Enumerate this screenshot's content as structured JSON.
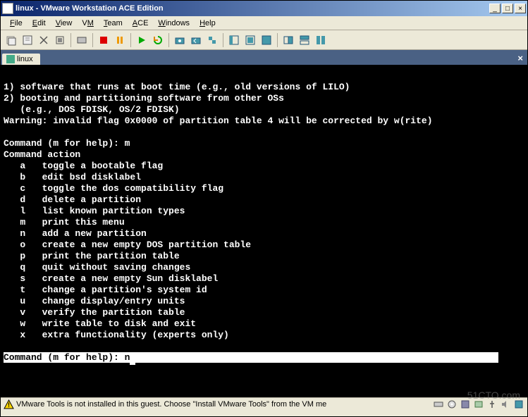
{
  "window": {
    "title": "linux - VMware Workstation ACE Edition"
  },
  "menu": {
    "file": "File",
    "edit": "Edit",
    "view": "View",
    "vm": "VM",
    "team": "Team",
    "ace": "ACE",
    "windows": "Windows",
    "help": "Help"
  },
  "tab": {
    "label": "linux"
  },
  "terminal": {
    "l1": "1) software that runs at boot time (e.g., old versions of LILO)",
    "l2": "2) booting and partitioning software from other OSs",
    "l3": "   (e.g., DOS FDISK, OS/2 FDISK)",
    "l4": "Warning: invalid flag 0x0000 of partition table 4 will be corrected by w(rite)",
    "l5": "",
    "l6": "Command (m for help): m",
    "l7": "Command action",
    "a": "   a   toggle a bootable flag",
    "b": "   b   edit bsd disklabel",
    "c": "   c   toggle the dos compatibility flag",
    "d": "   d   delete a partition",
    "ll": "   l   list known partition types",
    "m": "   m   print this menu",
    "n": "   n   add a new partition",
    "o": "   o   create a new empty DOS partition table",
    "p": "   p   print the partition table",
    "q": "   q   quit without saving changes",
    "s": "   s   create a new empty Sun disklabel",
    "t": "   t   change a partition's system id",
    "u": "   u   change display/entry units",
    "v": "   v   verify the partition table",
    "w": "   w   write table to disk and exit",
    "x": "   x   extra functionality (experts only)",
    "prompt": "Command (m for help): n"
  },
  "status": {
    "text": "VMware Tools is not installed in this guest. Choose \"Install VMware Tools\" from the VM me"
  },
  "watermark": "51CTO.com"
}
